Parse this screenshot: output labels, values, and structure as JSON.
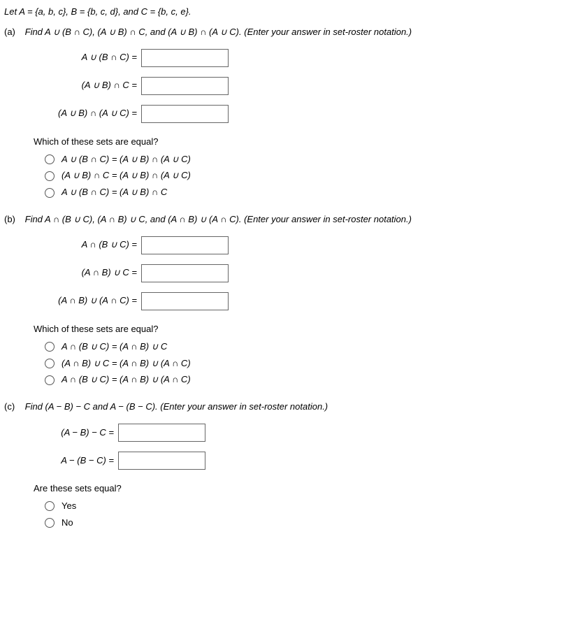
{
  "statement": "Let A = {a, b, c}, B = {b, c, d}, and C = {b, c, e}.",
  "a": {
    "label": "(a)",
    "prompt": "Find A ∪ (B ∩ C), (A ∪ B) ∩ C, and (A ∪ B) ∩ (A ∪ C). (Enter your answer in set-roster notation.)",
    "rows": [
      "A ∪ (B ∩ C)  =",
      "(A ∪ B) ∩ C  =",
      "(A ∪ B) ∩ (A ∪ C)  ="
    ],
    "subq": "Which of these sets are equal?",
    "opts": [
      "A ∪ (B ∩ C) = (A ∪ B) ∩ (A ∪ C)",
      "(A ∪ B) ∩ C = (A ∪ B) ∩ (A ∪ C)",
      "A ∪ (B ∩ C) = (A ∪ B) ∩ C"
    ]
  },
  "b": {
    "label": "(b)",
    "prompt": "Find A ∩ (B ∪ C), (A ∩ B) ∪ C, and (A ∩ B) ∪ (A ∩ C). (Enter your answer in set-roster notation.)",
    "rows": [
      "A ∩ (B ∪ C)  =",
      "(A ∩ B) ∪ C  =",
      "(A ∩ B) ∪ (A ∩ C)  ="
    ],
    "subq": "Which of these sets are equal?",
    "opts": [
      "A ∩ (B ∪ C) = (A ∩ B) ∪ C",
      "(A ∩ B) ∪ C = (A ∩ B) ∪ (A ∩ C)",
      "A ∩ (B ∪ C) = (A ∩ B) ∪ (A ∩ C)"
    ]
  },
  "c": {
    "label": "(c)",
    "prompt": "Find (A − B) − C and A − (B − C). (Enter your answer in set-roster notation.)",
    "rows": [
      "(A − B) − C  =",
      "A − (B − C)  ="
    ],
    "subq": "Are these sets equal?",
    "opts": [
      "Yes",
      "No"
    ]
  }
}
